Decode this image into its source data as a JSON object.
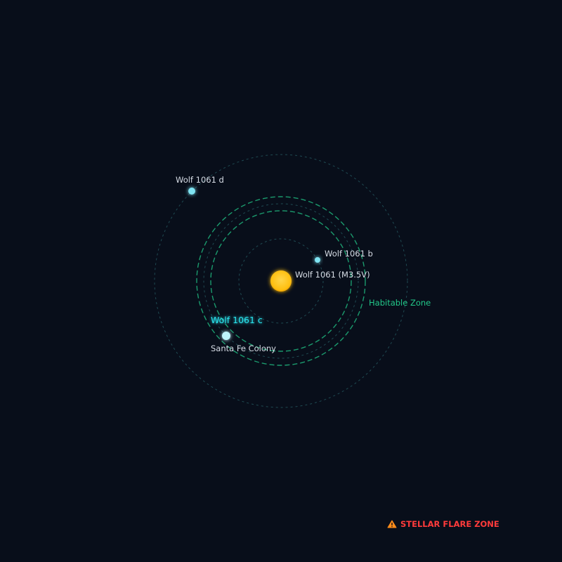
{
  "star": {
    "label": "Wolf 1061 (M3.5V)",
    "color": "#ffc21a"
  },
  "habitable_zone": {
    "label": "Habitable Zone",
    "color": "#22c98a"
  },
  "planets": [
    {
      "name": "Wolf 1061 b",
      "color": "#7fe3f2"
    },
    {
      "name": "Wolf 1061 c",
      "color": "#bff4fb",
      "highlight_color": "#2ae6f0",
      "colony": "Santa Fe Colony"
    },
    {
      "name": "Wolf 1061 d",
      "color": "#7fe3f2"
    }
  ],
  "warning": {
    "text": "STELLAR FLARE ZONE",
    "icon": "warning-triangle-icon",
    "color": "#ff3b3b"
  },
  "colors": {
    "background": "#080e1a",
    "orbit": "#1f4a52"
  }
}
